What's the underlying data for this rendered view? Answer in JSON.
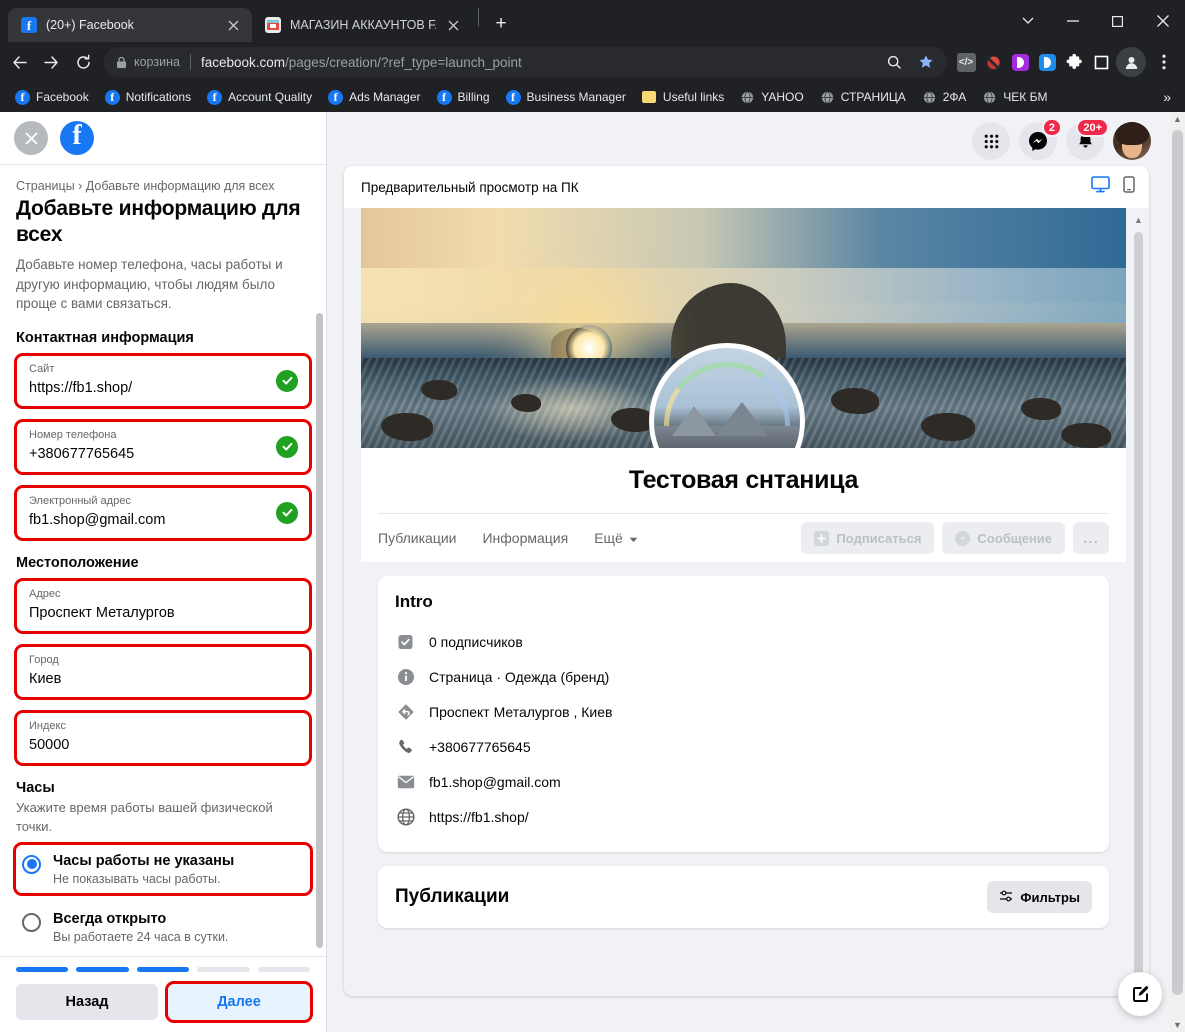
{
  "browser": {
    "tabs": [
      {
        "title": "(20+) Facebook",
        "favicon": "facebook-icon",
        "active": true
      },
      {
        "title": "МАГАЗИН АККАУНТОВ FACEBOO",
        "favicon": "shop-icon",
        "active": false
      }
    ],
    "new_tab_label": "+",
    "window_controls": [
      "tab-search-chevron",
      "minimize",
      "maximize",
      "close"
    ],
    "nav": {
      "back": "back-arrow",
      "forward": "forward-arrow",
      "reload": "reload"
    },
    "omnibox": {
      "secure_label": "корзина",
      "url_bold": "facebook.com",
      "url_rest": "/pages/creation/?ref_type=launch_point"
    },
    "omnibox_actions": [
      "search-icon",
      "bookmark-star-icon"
    ],
    "extensions": [
      "code-icon",
      "red-shield-icon",
      "purple-extension-icon",
      "blue-extension-icon",
      "puzzle-icon",
      "square-extension-icon",
      "profile-icon",
      "menu-icon"
    ],
    "bookmarks": [
      {
        "label": "Facebook",
        "icon": "facebook-icon"
      },
      {
        "label": "Notifications",
        "icon": "facebook-icon"
      },
      {
        "label": "Account Quality",
        "icon": "facebook-icon"
      },
      {
        "label": "Ads Manager",
        "icon": "facebook-icon"
      },
      {
        "label": "Billing",
        "icon": "facebook-icon"
      },
      {
        "label": "Business Manager",
        "icon": "facebook-icon"
      },
      {
        "label": "Useful links",
        "icon": "folder-icon"
      },
      {
        "label": "YAHOO",
        "icon": "globe-icon"
      },
      {
        "label": "СТРАНИЦА",
        "icon": "globe-icon"
      },
      {
        "label": "2ФА",
        "icon": "globe-icon"
      },
      {
        "label": "ЧЕК БМ",
        "icon": "globe-icon"
      }
    ],
    "bookmarks_overflow": "»"
  },
  "wizard": {
    "breadcrumb": "Страницы › Добавьте информацию для всех",
    "title": "Добавьте информацию для всех",
    "subtitle": "Добавьте номер телефона, часы работы и другую информацию, чтобы людям было проще с вами связаться.",
    "contact_section_title": "Контактная информация",
    "fields_contact": [
      {
        "label": "Сайт",
        "value": "https://fb1.shop/",
        "valid": true,
        "highlighted": true
      },
      {
        "label": "Номер телефона",
        "value": "+380677765645",
        "valid": true,
        "highlighted": true
      },
      {
        "label": "Электронный адрес",
        "value": "fb1.shop@gmail.com",
        "valid": true,
        "highlighted": true
      }
    ],
    "location_section_title": "Местоположение",
    "fields_location": [
      {
        "label": "Адрес",
        "value": "Проспект Металургов",
        "valid": false,
        "highlighted": true
      },
      {
        "label": "Город",
        "value": "Киев",
        "valid": false,
        "highlighted": true
      },
      {
        "label": "Индекс",
        "value": "50000",
        "valid": false,
        "highlighted": true
      }
    ],
    "hours_section_title": "Часы",
    "hours_description": "Укажите время работы вашей физической точки.",
    "hours_options": [
      {
        "title": "Часы работы не указаны",
        "subtitle": "Не показывать часы работы.",
        "selected": true,
        "highlighted": true
      },
      {
        "title": "Всегда открыто",
        "subtitle": "Вы работаете 24 часа в сутки.",
        "selected": false,
        "highlighted": false
      }
    ],
    "progress": {
      "total": 5,
      "completed": 3
    },
    "back_button": "Назад",
    "next_button": "Далее"
  },
  "fb_header": {
    "close_icon": "close-icon",
    "logo_icon": "facebook-icon",
    "grid_icon": "apps-grid-icon",
    "messenger_icon": "messenger-icon",
    "messenger_badge": "2",
    "bell_icon": "bell-icon",
    "bell_badge": "20+",
    "avatar": "user-avatar"
  },
  "preview": {
    "header_title": "Предварительный просмотр на ПК",
    "device_desktop_icon": "desktop-icon",
    "device_mobile_icon": "mobile-icon",
    "page_name": "Тестовая снтаница",
    "tabs": [
      {
        "label": "Публикации",
        "dropdown": false
      },
      {
        "label": "Информация",
        "dropdown": false
      },
      {
        "label": "Ещё",
        "dropdown": true
      }
    ],
    "actions": [
      {
        "label": "Подписаться",
        "icon": "plus-box-icon"
      },
      {
        "label": "Сообщение",
        "icon": "messenger-icon"
      },
      {
        "label": "...",
        "icon": "more-icon"
      }
    ],
    "intro": {
      "title": "Intro",
      "rows": [
        {
          "icon": "followers-icon",
          "text": "0 подписчиков"
        },
        {
          "icon": "info-icon",
          "text": "Страница · Одежда (бренд)"
        },
        {
          "icon": "location-icon",
          "text": "Проспект Металургов , Киев"
        },
        {
          "icon": "phone-icon",
          "text": "+380677765645"
        },
        {
          "icon": "email-icon",
          "text": "fb1.shop@gmail.com"
        },
        {
          "icon": "globe-icon",
          "text": "https://fb1.shop/"
        }
      ]
    },
    "posts": {
      "title": "Публикации",
      "filters_label": "Фильтры",
      "filters_icon": "filters-icon"
    }
  },
  "fab": {
    "icon": "edit-pencil-icon"
  },
  "colors": {
    "accent_blue": "#1877f2",
    "highlight_red": "#e60000",
    "valid_green": "#21a121",
    "badge_red": "#f02849",
    "page_bg": "#f0f2f5"
  }
}
